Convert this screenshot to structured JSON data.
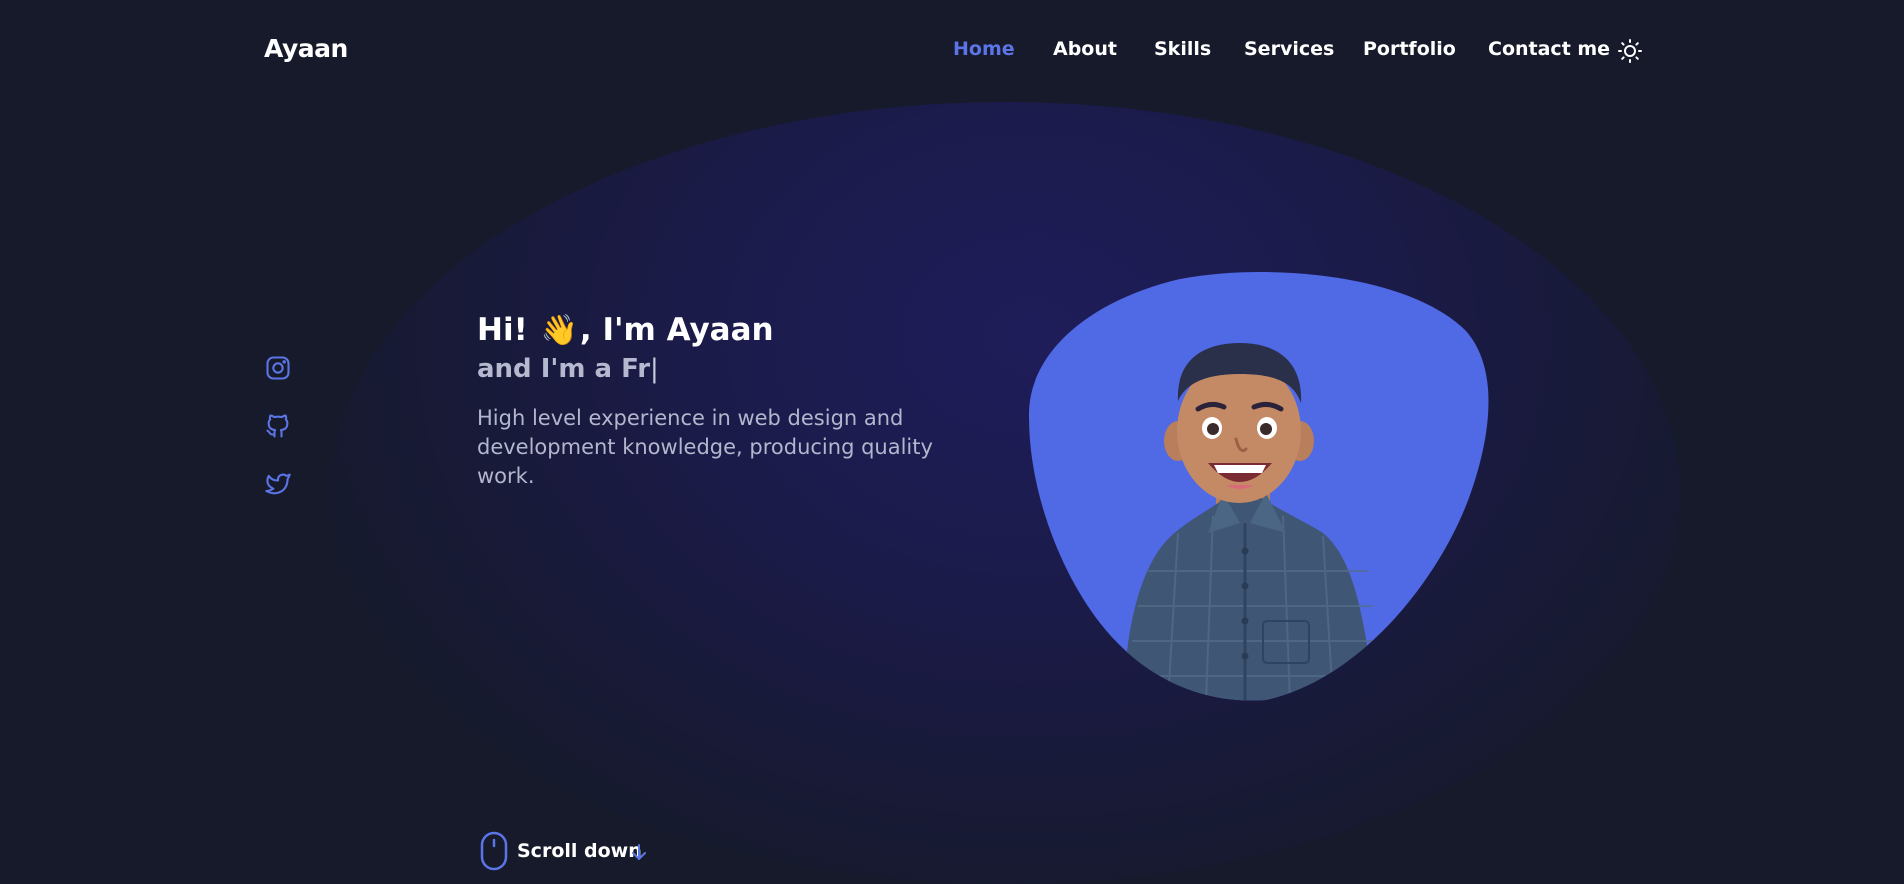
{
  "brand": {
    "logo": "Ayaan"
  },
  "nav": {
    "items": [
      {
        "label": "Home",
        "active": true
      },
      {
        "label": "About",
        "active": false
      },
      {
        "label": "Skills",
        "active": false
      },
      {
        "label": "Services",
        "active": false
      },
      {
        "label": "Portfolio",
        "active": false
      },
      {
        "label": "Contact me",
        "active": false
      }
    ],
    "theme_toggle_icon": "sun-icon"
  },
  "socials": [
    {
      "name": "instagram-icon"
    },
    {
      "name": "github-icon"
    },
    {
      "name": "twitter-icon"
    }
  ],
  "hero": {
    "greeting_start": "Hi!",
    "wave_emoji": "👋",
    "greeting_end": ", I'm Ayaan",
    "typed_text": "and I'm a Fr",
    "cursor": "|",
    "description": "High level experience in web design and development knowledge, producing quality work.",
    "avatar": "cartoon-avatar"
  },
  "scroll": {
    "label": "Scroll down",
    "icon": "mouse-icon",
    "arrow_icon": "arrow-down-icon"
  },
  "colors": {
    "background": "#161a2b",
    "accent": "#5b74e6",
    "blob": "#5069e4"
  }
}
